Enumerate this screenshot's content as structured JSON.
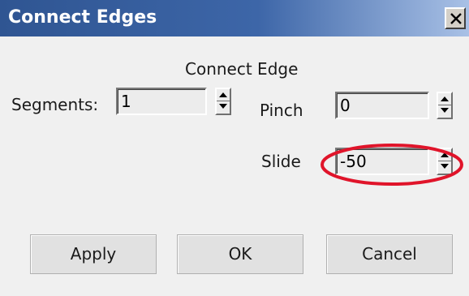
{
  "window": {
    "title": "Connect Edges",
    "close_icon": "close-icon"
  },
  "section": {
    "heading": "Connect Edge"
  },
  "segments": {
    "label": "Segments:",
    "value": "1"
  },
  "pinch": {
    "label": "Pinch",
    "value": "0"
  },
  "slide": {
    "label": "Slide",
    "value": "-50"
  },
  "buttons": {
    "apply": "Apply",
    "ok": "OK",
    "cancel": "Cancel"
  },
  "annotation": {
    "type": "ellipse",
    "target": "slide",
    "color": "#e0142a"
  },
  "colors": {
    "title_bar": "#3d66a8",
    "dialog_bg": "#f0f0f0"
  }
}
